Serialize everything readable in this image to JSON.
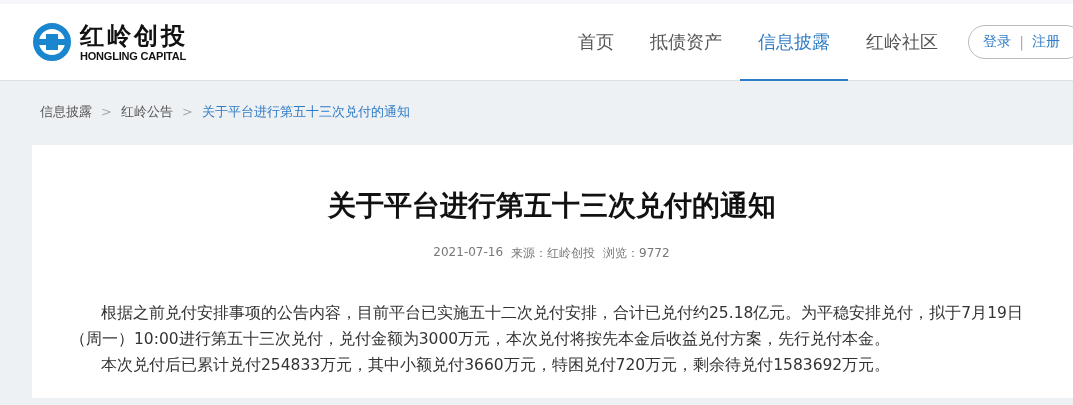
{
  "logo": {
    "name": "红岭创投",
    "subtitle": "HONGLING CAPITAL"
  },
  "nav": [
    {
      "label": "首页",
      "selected": false
    },
    {
      "label": "抵债资产",
      "selected": false
    },
    {
      "label": "信息披露",
      "selected": true
    },
    {
      "label": "红岭社区",
      "selected": false
    }
  ],
  "auth": {
    "login": "登录",
    "separator": "|",
    "register": "注册"
  },
  "breadcrumb": [
    {
      "label": "信息披露",
      "current": false
    },
    {
      "label": "红岭公告",
      "current": false
    },
    {
      "label": "关于平台进行第五十三次兑付的通知",
      "current": true
    }
  ],
  "breadcrumb_separator": ">",
  "article": {
    "title": "关于平台进行第五十三次兑付的通知",
    "date": "2021-07-16",
    "source": "来源：红岭创投",
    "views": "浏览：9772",
    "paragraphs": [
      "根据之前兑付安排事项的公告内容，目前平台已实施五十二次兑付安排，合计已兑付约25.18亿元。为平稳安排兑付，拟于7月19日（周一）10:00进行第五十三次兑付，兑付金额为3000万元，本次兑付将按先本金后收益兑付方案，先行兑付本金。",
      "本次兑付后已累计兑付254833万元，其中小额兑付3660万元，特困兑付720万元，剩余待兑付1583692万元。"
    ]
  }
}
